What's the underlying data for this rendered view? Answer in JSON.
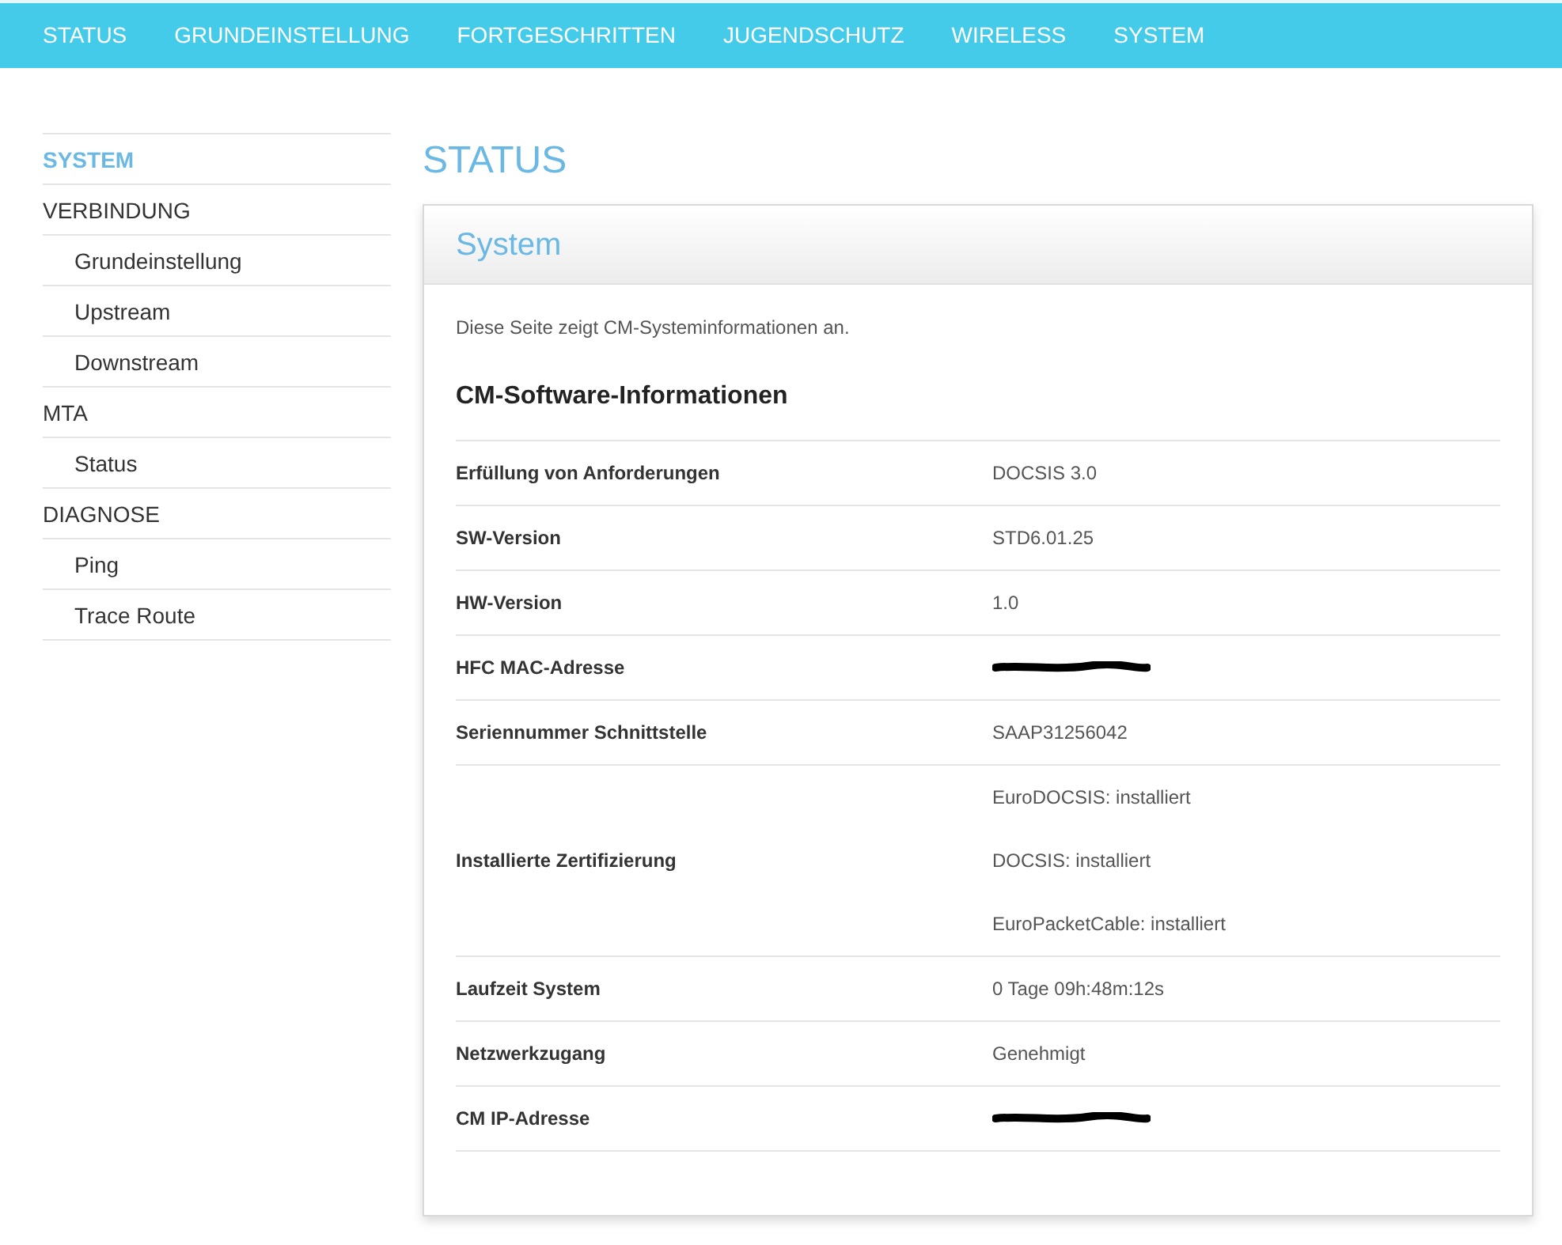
{
  "nav": [
    {
      "label": "STATUS"
    },
    {
      "label": "GRUNDEINSTELLUNG"
    },
    {
      "label": "FORTGESCHRITTEN"
    },
    {
      "label": "JUGENDSCHUTZ"
    },
    {
      "label": "WIRELESS"
    },
    {
      "label": "SYSTEM"
    }
  ],
  "sidebar": {
    "items": [
      {
        "label": "SYSTEM",
        "selected": true
      },
      {
        "label": "VERBINDUNG",
        "selected": false,
        "children": [
          {
            "label": "Grundeinstellung",
            "selected": false
          },
          {
            "label": "Upstream",
            "selected": false
          },
          {
            "label": "Downstream",
            "selected": false
          }
        ]
      },
      {
        "label": "MTA",
        "selected": false,
        "children": [
          {
            "label": "Status",
            "selected": false
          }
        ]
      },
      {
        "label": "DIAGNOSE",
        "selected": false,
        "children": [
          {
            "label": "Ping",
            "selected": false
          },
          {
            "label": "Trace Route",
            "selected": false
          }
        ]
      }
    ]
  },
  "page_title": "STATUS",
  "panel": {
    "title": "System",
    "description": "Diese Seite zeigt CM-Systeminformationen an.",
    "section_title": "CM-Software-Informationen",
    "rows": [
      {
        "label": "Erfüllung von Anforderungen",
        "values": [
          "DOCSIS 3.0"
        ],
        "redacted": false
      },
      {
        "label": "SW-Version",
        "values": [
          "STD6.01.25"
        ],
        "redacted": false
      },
      {
        "label": "HW-Version",
        "values": [
          "1.0"
        ],
        "redacted": false
      },
      {
        "label": "HFC MAC-Adresse",
        "redacted": true
      },
      {
        "label": "Seriennummer Schnittstelle",
        "values": [
          "SAAP31256042"
        ],
        "redacted": false
      },
      {
        "label": "Installierte Zertifizierung",
        "values": [
          "EuroDOCSIS: installiert",
          "DOCSIS: installiert",
          "EuroPacketCable: installiert"
        ],
        "redacted": false
      },
      {
        "label": "Laufzeit System",
        "values": [
          "0 Tage 09h:48m:12s"
        ],
        "redacted": false
      },
      {
        "label": "Netzwerkzugang",
        "values": [
          "Genehmigt"
        ],
        "redacted": false
      },
      {
        "label": "CM IP-Adresse",
        "redacted": true
      }
    ]
  }
}
